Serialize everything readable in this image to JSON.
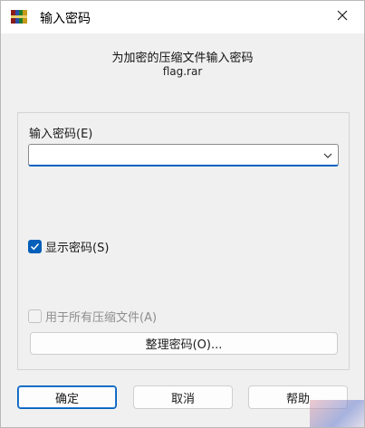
{
  "window": {
    "title": "输入密码",
    "heading": "为加密的压缩文件输入密码",
    "filename": "flag.rar"
  },
  "password": {
    "label": "输入密码(E)",
    "value": ""
  },
  "options": {
    "show_password_label": "显示密码(S)",
    "show_password_checked": true,
    "use_for_all_label": "用于所有压缩文件(A)",
    "use_for_all_checked": false,
    "use_for_all_enabled": false
  },
  "organize_button_label": "整理密码(O)...",
  "buttons": {
    "ok": "确定",
    "cancel": "取消",
    "help": "帮助"
  },
  "icons": {
    "app": "winrar-books-icon",
    "close": "close-icon",
    "dropdown": "chevron-down-icon",
    "check": "checkmark-icon"
  },
  "colors": {
    "accent": "#005fb8"
  }
}
